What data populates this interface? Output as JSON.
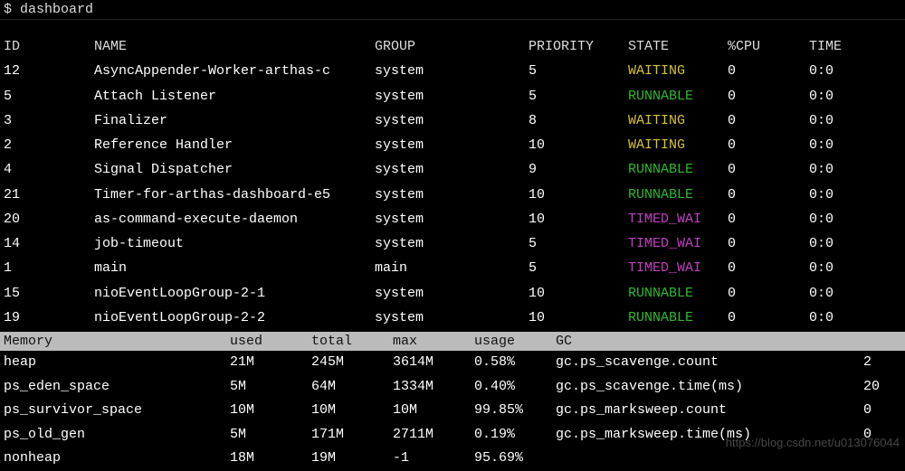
{
  "prompt": "$ dashboard",
  "thread_headers": {
    "id": "ID",
    "name": "NAME",
    "group": "GROUP",
    "priority": "PRIORITY",
    "state": "STATE",
    "cpu": "%CPU",
    "time": "TIME"
  },
  "threads": [
    {
      "id": "12",
      "name": "AsyncAppender-Worker-arthas-c",
      "group": "system",
      "priority": "5",
      "state": "WAITING",
      "state_class": "state-waiting",
      "cpu": "0",
      "time": "0:0"
    },
    {
      "id": "5",
      "name": "Attach Listener",
      "group": "system",
      "priority": "5",
      "state": "RUNNABLE",
      "state_class": "state-runnable",
      "cpu": "0",
      "time": "0:0"
    },
    {
      "id": "3",
      "name": "Finalizer",
      "group": "system",
      "priority": "8",
      "state": "WAITING",
      "state_class": "state-waiting",
      "cpu": "0",
      "time": "0:0"
    },
    {
      "id": "2",
      "name": "Reference Handler",
      "group": "system",
      "priority": "10",
      "state": "WAITING",
      "state_class": "state-waiting",
      "cpu": "0",
      "time": "0:0"
    },
    {
      "id": "4",
      "name": "Signal Dispatcher",
      "group": "system",
      "priority": "9",
      "state": "RUNNABLE",
      "state_class": "state-runnable",
      "cpu": "0",
      "time": "0:0"
    },
    {
      "id": "21",
      "name": "Timer-for-arthas-dashboard-e5",
      "group": "system",
      "priority": "10",
      "state": "RUNNABLE",
      "state_class": "state-runnable",
      "cpu": "0",
      "time": "0:0"
    },
    {
      "id": "20",
      "name": "as-command-execute-daemon",
      "group": "system",
      "priority": "10",
      "state": "TIMED_WAI",
      "state_class": "state-timedwai",
      "cpu": "0",
      "time": "0:0"
    },
    {
      "id": "14",
      "name": "job-timeout",
      "group": "system",
      "priority": "5",
      "state": "TIMED_WAI",
      "state_class": "state-timedwai",
      "cpu": "0",
      "time": "0:0"
    },
    {
      "id": "1",
      "name": "main",
      "group": "main",
      "priority": "5",
      "state": "TIMED_WAI",
      "state_class": "state-timedwai",
      "cpu": "0",
      "time": "0:0"
    },
    {
      "id": "15",
      "name": "nioEventLoopGroup-2-1",
      "group": "system",
      "priority": "10",
      "state": "RUNNABLE",
      "state_class": "state-runnable",
      "cpu": "0",
      "time": "0:0"
    },
    {
      "id": "19",
      "name": "nioEventLoopGroup-2-2",
      "group": "system",
      "priority": "10",
      "state": "RUNNABLE",
      "state_class": "state-runnable",
      "cpu": "0",
      "time": "0:0"
    }
  ],
  "mem_headers": {
    "memory": "Memory",
    "used": "used",
    "total": "total",
    "max": "max",
    "usage": "usage",
    "gc": "GC"
  },
  "mem_rows": [
    {
      "label": "heap",
      "used": "21M",
      "total": "245M",
      "max": "3614M",
      "usage": "0.58%",
      "gc": "gc.ps_scavenge.count",
      "gcval": "2"
    },
    {
      "label": "ps_eden_space",
      "used": "5M",
      "total": "64M",
      "max": "1334M",
      "usage": "0.40%",
      "gc": "gc.ps_scavenge.time(ms)",
      "gcval": "20"
    },
    {
      "label": "ps_survivor_space",
      "used": "10M",
      "total": "10M",
      "max": "10M",
      "usage": "99.85%",
      "gc": "gc.ps_marksweep.count",
      "gcval": "0"
    },
    {
      "label": "ps_old_gen",
      "used": "5M",
      "total": "171M",
      "max": "2711M",
      "usage": "0.19%",
      "gc": "gc.ps_marksweep.time(ms)",
      "gcval": "0"
    },
    {
      "label": "nonheap",
      "used": "18M",
      "total": "19M",
      "max": "-1",
      "usage": "95.69%",
      "gc": "",
      "gcval": ""
    }
  ],
  "watermark": "https://blog.csdn.net/u013076044"
}
